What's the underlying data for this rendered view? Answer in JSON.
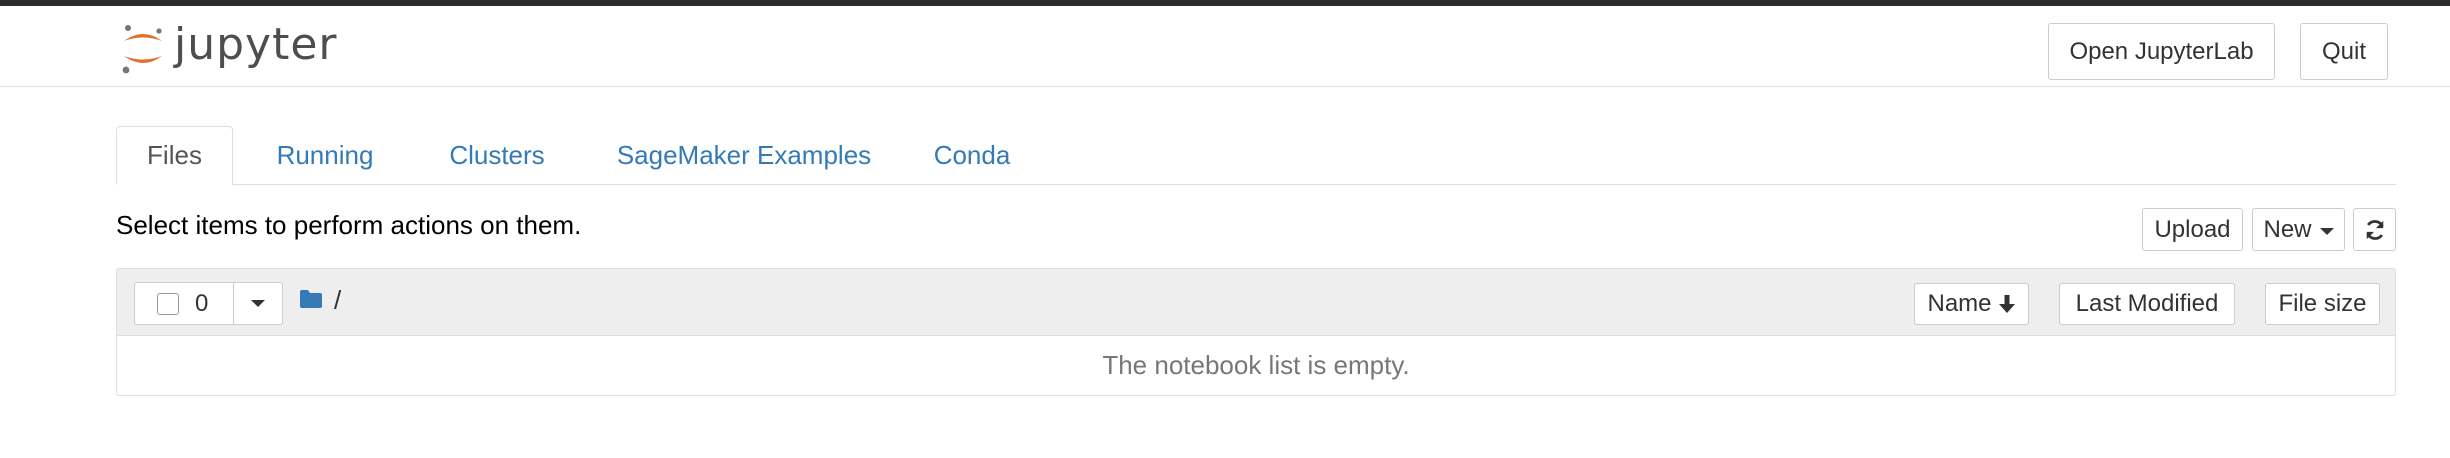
{
  "header": {
    "logo_text": "jupyter",
    "open_jupyterlab_label": "Open JupyterLab",
    "quit_label": "Quit"
  },
  "tabs": [
    {
      "label": "Files",
      "active": true
    },
    {
      "label": "Running",
      "active": false
    },
    {
      "label": "Clusters",
      "active": false
    },
    {
      "label": "SageMaker Examples",
      "active": false
    },
    {
      "label": "Conda",
      "active": false
    }
  ],
  "toolbar": {
    "instructions": "Select items to perform actions on them.",
    "upload_label": "Upload",
    "new_label": "New",
    "refresh_icon": "refresh-icon"
  },
  "list": {
    "selected_count": "0",
    "path": "/",
    "sort_name_label": "Name",
    "sort_modified_label": "Last Modified",
    "sort_size_label": "File size",
    "empty_message": "The notebook list is empty."
  },
  "colors": {
    "link": "#337ab7",
    "logo_orange": "#e46e2e",
    "topbar": "#2b2b2b",
    "list_header_bg": "#eeeeee"
  }
}
